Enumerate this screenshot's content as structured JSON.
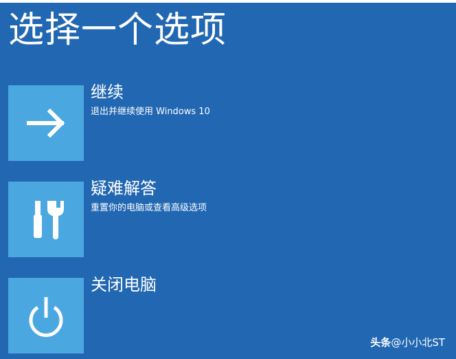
{
  "header": {
    "title": "选择一个选项"
  },
  "options": [
    {
      "title": "继续",
      "description": "退出并继续使用 Windows 10",
      "icon": "arrow-right-icon"
    },
    {
      "title": "疑难解答",
      "description": "重置你的电脑或查看高级选项",
      "icon": "tools-icon"
    },
    {
      "title": "关闭电脑",
      "description": "",
      "icon": "power-icon"
    }
  ],
  "watermark": {
    "brand": "头条",
    "handle": "@小小北ST"
  },
  "colors": {
    "background": "#2167b2",
    "tile": "#4ba7e0",
    "text": "#ffffff"
  }
}
